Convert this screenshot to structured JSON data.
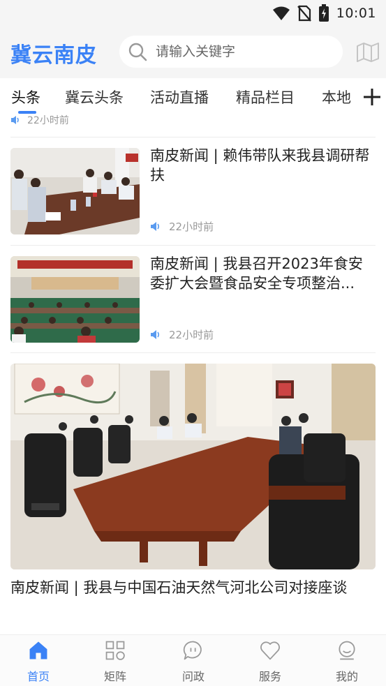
{
  "status_bar": {
    "time": "10:01"
  },
  "header": {
    "logo": "冀云南皮",
    "search_placeholder": "请输入关键字"
  },
  "tabs": [
    {
      "label": "头条",
      "active": true
    },
    {
      "label": "冀云头条",
      "active": false
    },
    {
      "label": "活动直播",
      "active": false
    },
    {
      "label": "精品栏目",
      "active": false
    },
    {
      "label": "本地",
      "active": false
    }
  ],
  "feed": {
    "partial_time": "22小时前",
    "items": [
      {
        "title": "南皮新闻 | 赖伟带队来我县调研帮扶",
        "time": "22小时前"
      },
      {
        "title": "南皮新闻 | 我县召开2023年食安委扩大会暨食品安全专项整治...",
        "time": "22小时前"
      }
    ],
    "big_card": {
      "title": "南皮新闻 | 我县与中国石油天然气河北公司对接座谈"
    }
  },
  "bottom_nav": [
    {
      "label": "首页",
      "icon": "home-icon",
      "active": true
    },
    {
      "label": "矩阵",
      "icon": "grid-icon",
      "active": false
    },
    {
      "label": "问政",
      "icon": "chat-icon",
      "active": false
    },
    {
      "label": "服务",
      "icon": "heart-icon",
      "active": false
    },
    {
      "label": "我的",
      "icon": "profile-icon",
      "active": false
    }
  ],
  "colors": {
    "accent": "#3b82f6",
    "text": "#222222",
    "muted": "#999999",
    "bar_bg": "#f5f5f5"
  }
}
